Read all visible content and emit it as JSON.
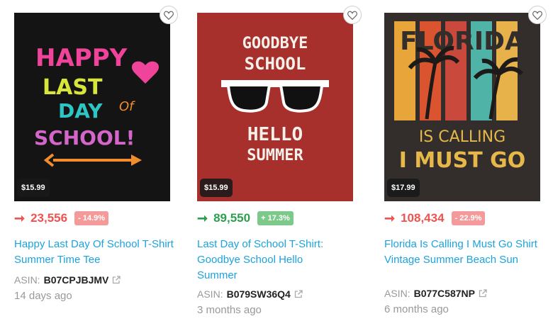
{
  "products": [
    {
      "image_alt": "Happy Last Day of School shirt design",
      "art_lines": [
        "HAPPY",
        "LAST",
        "DAY",
        "Of",
        "SCHOOL!"
      ],
      "price": "$15.99",
      "rank": "23,556",
      "trend": "down",
      "change": "- 14.9%",
      "title": "Happy Last Day Of School T-Shirt Summer Time Tee",
      "asin_label": "ASIN:",
      "asin": "B07CPJBJMV",
      "ago": "14 days ago"
    },
    {
      "image_alt": "Goodbye School Hello Summer shirt design",
      "art_lines": [
        "GOODBYE",
        "SCHOOL",
        "HELLO",
        "SUMMER"
      ],
      "price": "$15.99",
      "rank": "89,550",
      "trend": "up",
      "change": "+ 17.3%",
      "title": "Last Day of School T-Shirt: Goodbye School Hello Summer",
      "asin_label": "ASIN:",
      "asin": "B079SW36Q4",
      "ago": "3 months ago"
    },
    {
      "image_alt": "Florida Is Calling I Must Go shirt design",
      "art_lines": [
        "FLORIDA",
        "IS CALLING",
        "I MUST GO"
      ],
      "price": "$17.99",
      "rank": "108,434",
      "trend": "down",
      "change": "- 22.9%",
      "title": "Florida Is Calling I Must Go Shirt Vintage Summer Beach Sun",
      "asin_label": "ASIN:",
      "asin": "B077C587NP",
      "ago": "6 months ago"
    }
  ],
  "icons": {
    "favorite": "heart-outline-icon",
    "trend_down": "arrow-right-down-icon",
    "trend_up": "arrow-right-up-icon",
    "external": "external-link-icon"
  },
  "colors": {
    "link": "#1aa3de",
    "down": "#ef5350",
    "up": "#2e9e4f"
  }
}
